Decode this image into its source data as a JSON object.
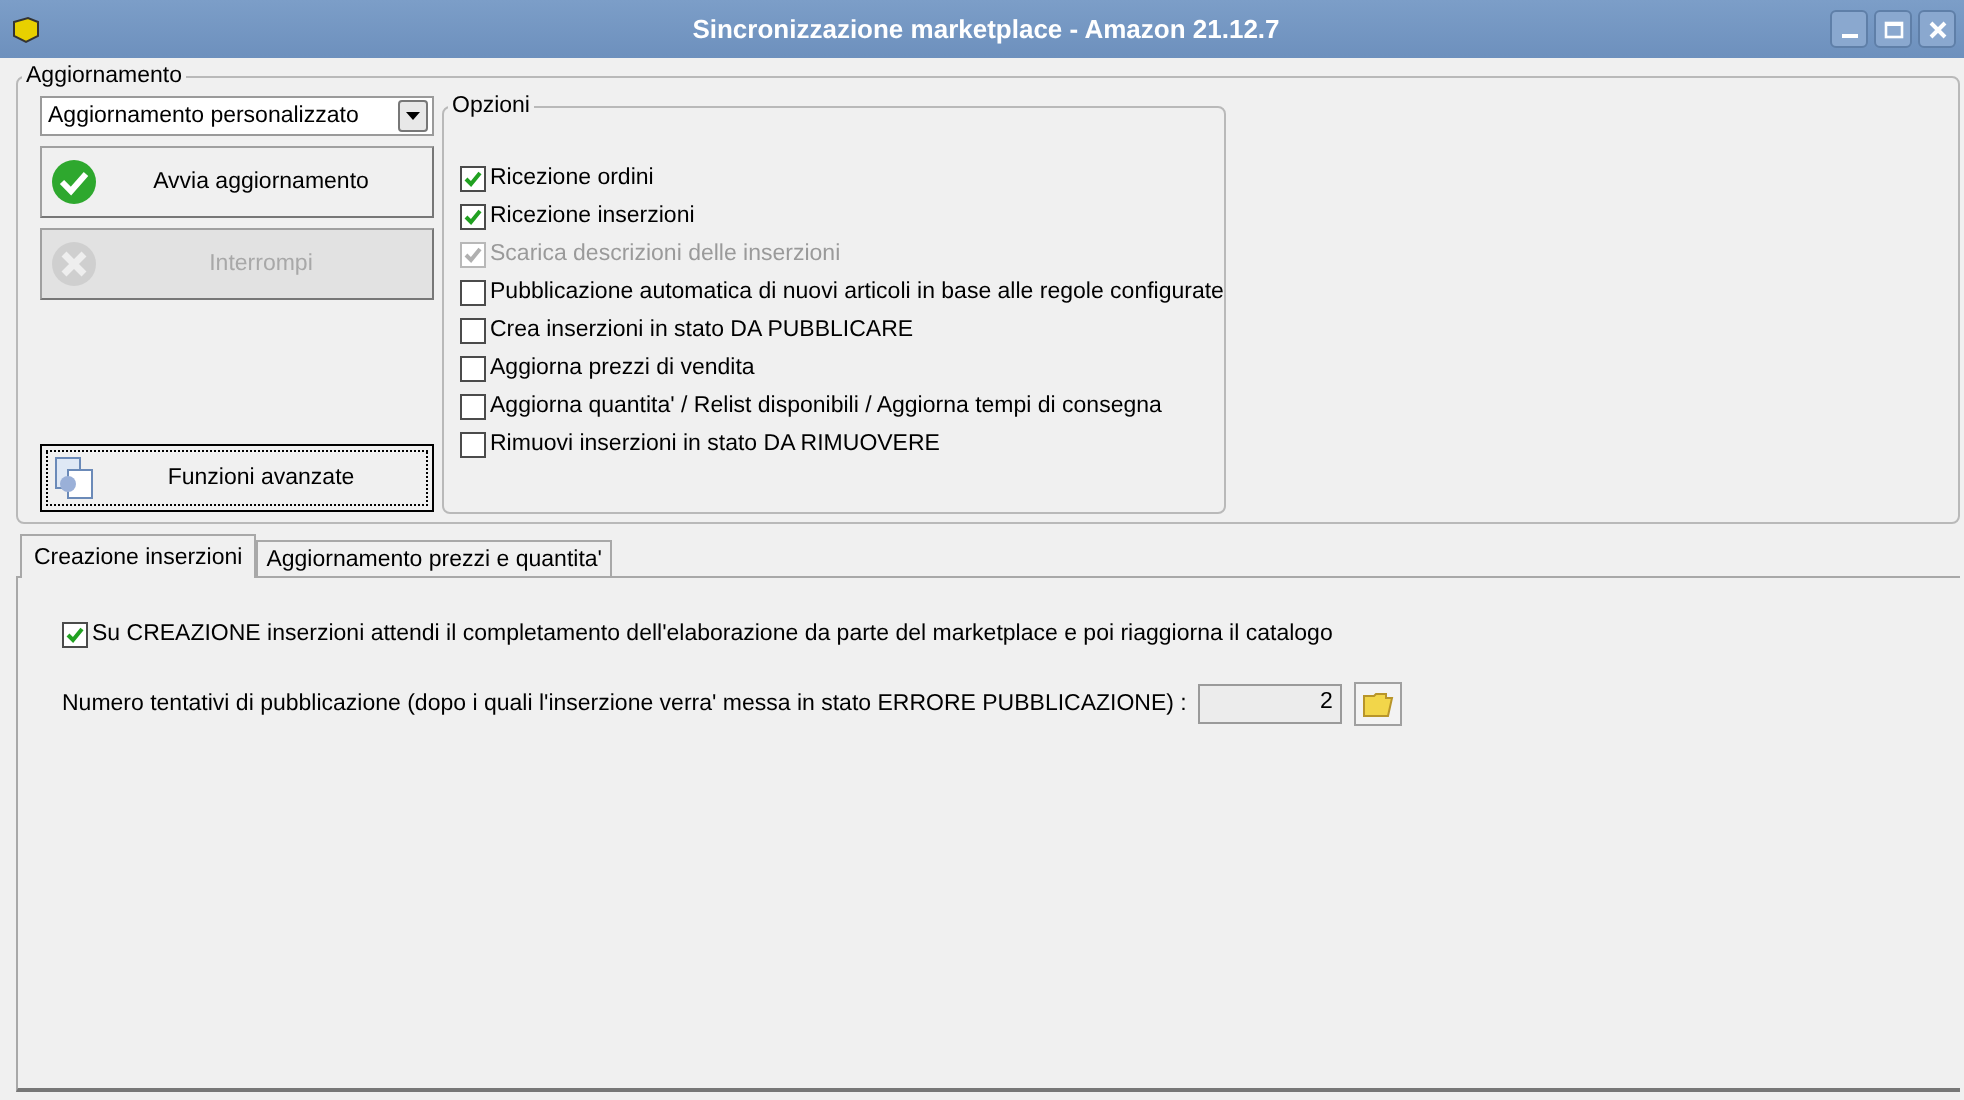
{
  "window": {
    "title": "Sincronizzazione marketplace - Amazon 21.12.7"
  },
  "update_group": {
    "title": "Aggiornamento",
    "mode": "Aggiornamento personalizzato",
    "buttons": [
      {
        "kind": "start",
        "label": "Avvia aggiornamento",
        "disabled": false
      },
      {
        "kind": "stop",
        "label": "Interrompi",
        "disabled": true
      }
    ],
    "advanced_button": {
      "label": "Funzioni avanzate"
    }
  },
  "options": {
    "title": "Opzioni",
    "items": [
      {
        "label": "Ricezione ordini",
        "checked": true,
        "disabled": false
      },
      {
        "label": "Ricezione inserzioni",
        "checked": true,
        "disabled": false
      },
      {
        "label": "Scarica descrizioni delle inserzioni",
        "checked": true,
        "disabled": true
      },
      {
        "label": "Pubblicazione automatica di nuovi articoli in base alle regole configurate",
        "checked": false,
        "disabled": false
      },
      {
        "label": "Crea inserzioni in stato DA PUBBLICARE",
        "checked": false,
        "disabled": false
      },
      {
        "label": "Aggiorna prezzi di vendita",
        "checked": false,
        "disabled": false
      },
      {
        "label": "Aggiorna quantita' / Relist disponibili / Aggiorna tempi di consegna",
        "checked": false,
        "disabled": false
      },
      {
        "label": "Rimuovi inserzioni in stato DA RIMUOVERE",
        "checked": false,
        "disabled": false
      }
    ]
  },
  "tabs": [
    {
      "label": "Creazione inserzioni",
      "selected": true
    },
    {
      "label": "Aggiornamento prezzi e quantita'",
      "selected": false
    }
  ],
  "tab_panel": {
    "wait_option": {
      "label": "Su CREAZIONE inserzioni attendi il completamento dell'elaborazione da parte del marketplace e poi riaggiorna il catalogo",
      "checked": true
    },
    "retries": {
      "label": "Numero tentativi di pubblicazione (dopo i quali l'inserzione verra' messa in stato ERRORE PUBBLICAZIONE) :",
      "value": "2"
    }
  }
}
